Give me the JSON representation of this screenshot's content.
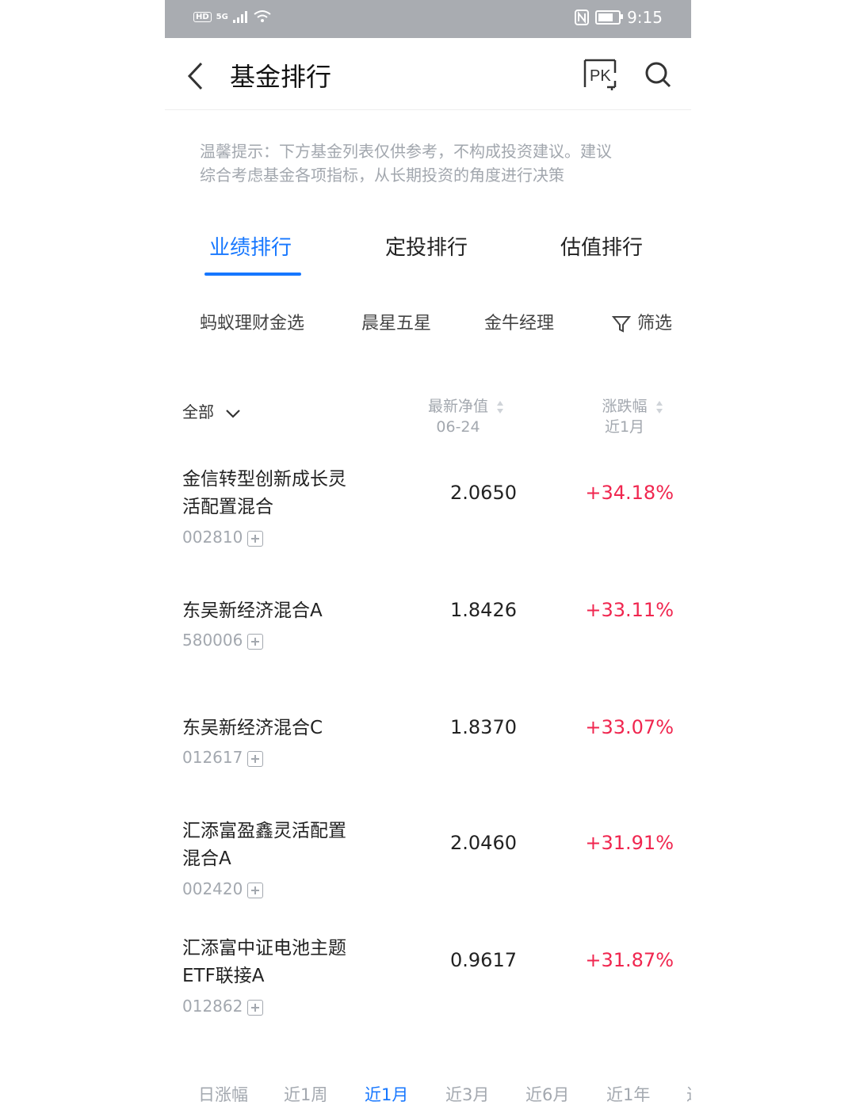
{
  "status": {
    "time": "9:15",
    "network": "5G"
  },
  "nav": {
    "title": "基金排行"
  },
  "tip": {
    "line1": "温馨提示：下方基金列表仅供参考，不构成投资建议。建议",
    "line2": "综合考虑基金各项指标，从长期投资的角度进行决策"
  },
  "tabs": [
    "业绩排行",
    "定投排行",
    "估值排行"
  ],
  "filters": [
    "蚂蚁理财金选",
    "晨星五星",
    "金牛经理",
    "筛选"
  ],
  "list_header": {
    "all": "全部",
    "nav_label": "最新净值",
    "nav_date": "06-24",
    "chg_label": "涨跌幅",
    "chg_period": "近1月"
  },
  "funds": [
    {
      "name1": "金信转型创新成长灵",
      "name2": "活配置混合",
      "code": "002810",
      "nav": "2.0650",
      "change": "+34.18%"
    },
    {
      "name1": "东吴新经济混合A",
      "name2": "",
      "code": "580006",
      "nav": "1.8426",
      "change": "+33.11%"
    },
    {
      "name1": "东吴新经济混合C",
      "name2": "",
      "code": "012617",
      "nav": "1.8370",
      "change": "+33.07%"
    },
    {
      "name1": "汇添富盈鑫灵活配置",
      "name2": "混合A",
      "code": "002420",
      "nav": "2.0460",
      "change": "+31.91%"
    },
    {
      "name1": "汇添富中证电池主题",
      "name2": "ETF联接A",
      "code": "012862",
      "nav": "0.9617",
      "change": "+31.87%"
    }
  ],
  "periods": [
    "日涨幅",
    "近1周",
    "近1月",
    "近3月",
    "近6月",
    "近1年",
    "近"
  ],
  "colors": {
    "accent": "#1677ff",
    "up": "#f0264f",
    "muted": "#a3a8af"
  }
}
